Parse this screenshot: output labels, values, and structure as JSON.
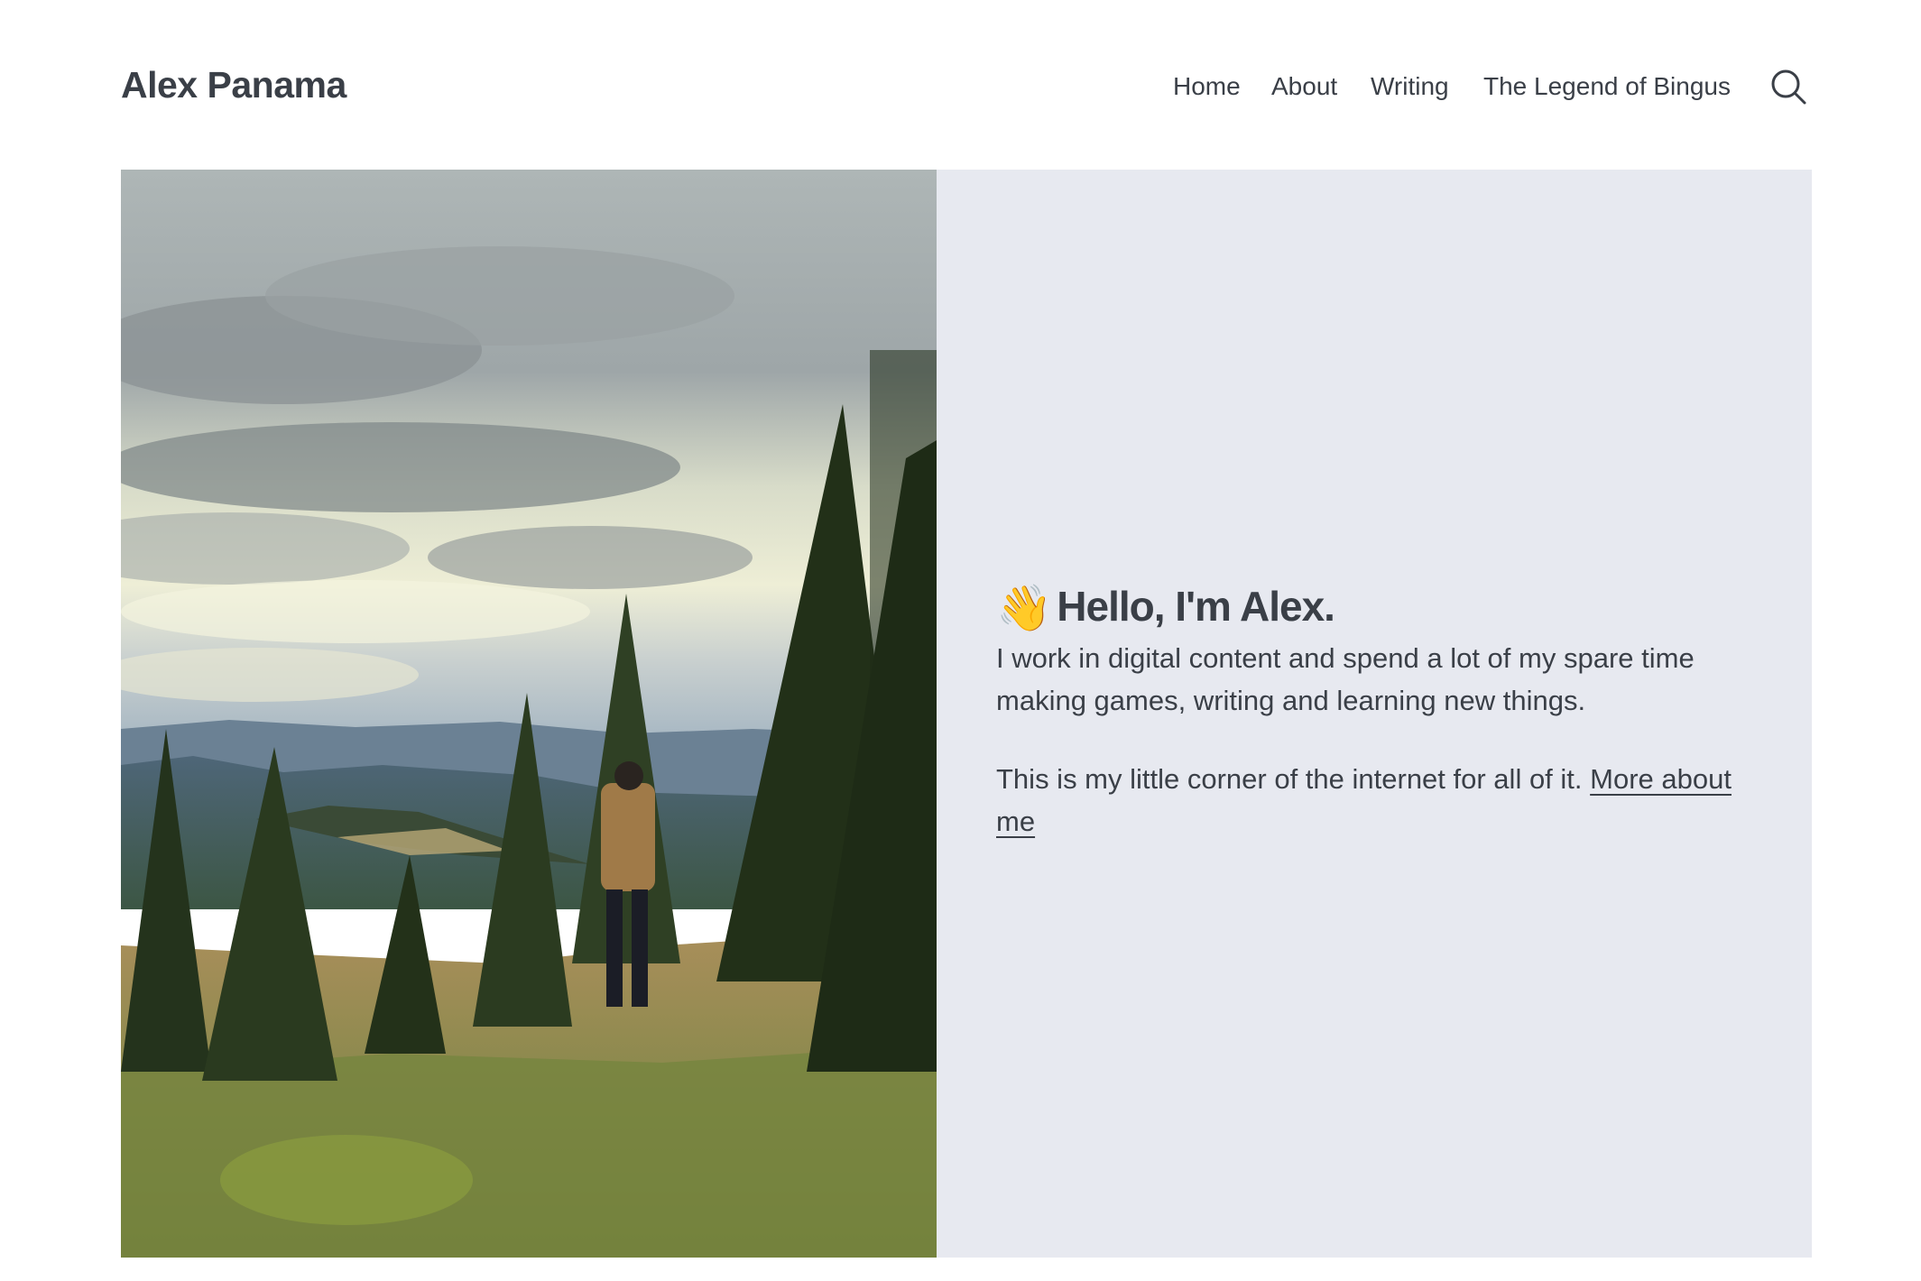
{
  "header": {
    "site_title": "Alex Panama",
    "nav": [
      {
        "label": "Home"
      },
      {
        "label": "About"
      },
      {
        "label": "Writing"
      },
      {
        "label": "The Legend of Bingus"
      }
    ],
    "search_icon": "search-icon"
  },
  "hero": {
    "photo_icon": "landscape-photo",
    "wave_emoji": "👋",
    "heading": "Hello, I'm Alex.",
    "intro": "I work in digital content and spend a lot of my spare time making games, writing and learning new things.",
    "corner_text": "This is my little corner of the internet for all of it. ",
    "more_link": "More about me"
  },
  "colors": {
    "text": "#3a3f47",
    "panel_bg": "#e7e9f0",
    "page_bg": "#ffffff"
  }
}
